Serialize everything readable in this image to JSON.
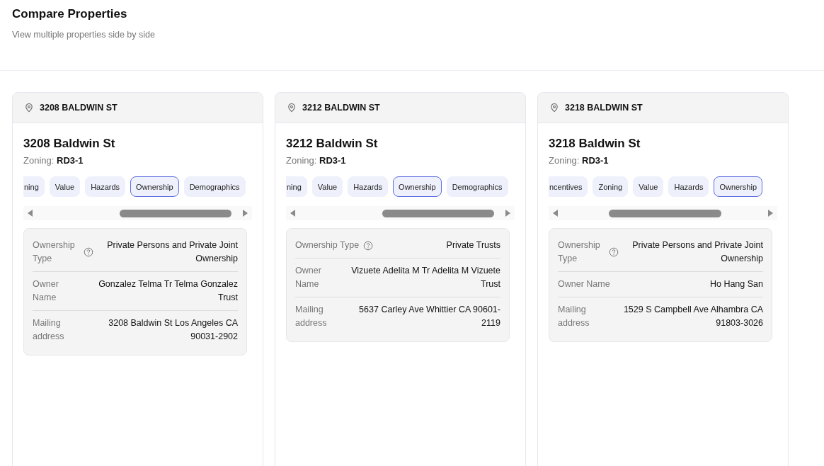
{
  "page": {
    "title": "Compare Properties",
    "subtitle": "View multiple properties side by side"
  },
  "cards": [
    {
      "header": "3208 BALDWIN ST",
      "title": "3208 Baldwin St",
      "zoning_label": "Zoning:",
      "zoning_value": "RD3-1",
      "tabs": [
        {
          "label": "ning",
          "selected": false
        },
        {
          "label": "Value",
          "selected": false
        },
        {
          "label": "Hazards",
          "selected": false
        },
        {
          "label": "Ownership",
          "selected": true
        },
        {
          "label": "Demographics",
          "selected": false
        }
      ],
      "details": [
        {
          "label": "Ownership Type",
          "help": true,
          "value": "Private Persons and Private Joint Ownership"
        },
        {
          "label": "Owner Name",
          "help": false,
          "value": "Gonzalez Telma Tr Telma Gonzalez Trust"
        },
        {
          "label": "Mailing address",
          "help": false,
          "value": "3208 Baldwin St Los Angeles CA 90031-2902"
        }
      ]
    },
    {
      "header": "3212 BALDWIN ST",
      "title": "3212 Baldwin St",
      "zoning_label": "Zoning:",
      "zoning_value": "RD3-1",
      "tabs": [
        {
          "label": "ning",
          "selected": false
        },
        {
          "label": "Value",
          "selected": false
        },
        {
          "label": "Hazards",
          "selected": false
        },
        {
          "label": "Ownership",
          "selected": true
        },
        {
          "label": "Demographics",
          "selected": false
        }
      ],
      "details": [
        {
          "label": "Ownership Type",
          "help": true,
          "value": "Private Trusts"
        },
        {
          "label": "Owner Name",
          "help": false,
          "value": "Vizuete Adelita M Tr Adelita M Vizuete Trust"
        },
        {
          "label": "Mailing address",
          "help": false,
          "value": "5637 Carley Ave Whittier CA 90601-2119"
        }
      ]
    },
    {
      "header": "3218 BALDWIN ST",
      "title": "3218 Baldwin St",
      "zoning_label": "Zoning:",
      "zoning_value": "RD3-1",
      "tabs": [
        {
          "label": "ncentives",
          "selected": false
        },
        {
          "label": "Zoning",
          "selected": false
        },
        {
          "label": "Value",
          "selected": false
        },
        {
          "label": "Hazards",
          "selected": false
        },
        {
          "label": "Ownership",
          "selected": true
        }
      ],
      "details": [
        {
          "label": "Ownership Type",
          "help": true,
          "value": "Private Persons and Private Joint Ownership"
        },
        {
          "label": "Owner Name",
          "help": false,
          "value": "Ho Hang San"
        },
        {
          "label": "Mailing address",
          "help": false,
          "value": "1529 S Campbell Ave Alhambra CA 91803-3026"
        }
      ]
    }
  ]
}
